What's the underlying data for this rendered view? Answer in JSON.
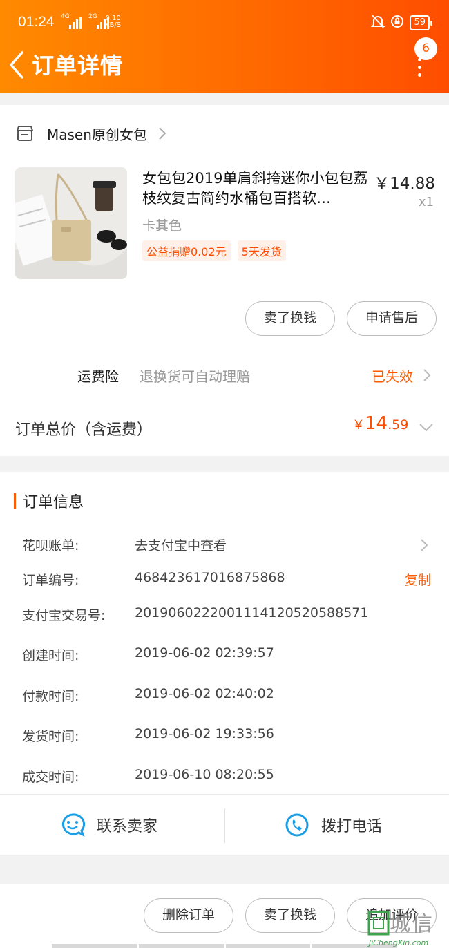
{
  "status_bar": {
    "time": "01:24",
    "net1_tag": "4G",
    "net2_tag": "2G",
    "speed_value": "0.10",
    "speed_unit": "KB/S",
    "battery": "59"
  },
  "header": {
    "title": "订单详情",
    "badge_count": "6"
  },
  "shop": {
    "name": "Masen原创女包"
  },
  "product": {
    "title": "女包包2019单肩斜挎迷你小包包荔枝纹复古简约水桶包百搭软…",
    "price": "￥14.88",
    "quantity": "x1",
    "sku": "卡其色",
    "tags": [
      "公益捐赠0.02元",
      "5天发货"
    ]
  },
  "item_actions": {
    "sell_label": "卖了换钱",
    "after_sale_label": "申请售后"
  },
  "insurance": {
    "name": "运费险",
    "desc": "退换货可自动理赔",
    "status": "已失效"
  },
  "total": {
    "label": "订单总价（含运费）",
    "symbol": "￥",
    "integer": "14",
    "decimal": ".59"
  },
  "order_info": {
    "heading": "订单信息",
    "rows": [
      {
        "label": "花呗账单:",
        "value": "去支付宝中查看"
      },
      {
        "label": "订单编号:",
        "value": "468423617016875868",
        "action": "复制"
      },
      {
        "label": "支付宝交易号:",
        "value": "2019060222001114120520588571"
      },
      {
        "label": "创建时间:",
        "value": "2019-06-02 02:39:57"
      },
      {
        "label": "付款时间:",
        "value": "2019-06-02 02:40:02"
      },
      {
        "label": "发货时间:",
        "value": "2019-06-02 19:33:56"
      },
      {
        "label": "成交时间:",
        "value": "2019-06-10 08:20:55"
      }
    ]
  },
  "contact": {
    "seller_label": "联系卖家",
    "call_label": "拨打电话"
  },
  "bottom_actions": {
    "delete_label": "删除订单",
    "sell_label": "卖了换钱",
    "review_label": "追加评价"
  },
  "watermark": {
    "text": "城信",
    "subtext": "JiChengXin.com"
  },
  "colors": {
    "accent": "#ff5a00",
    "header_start": "#ff8a00",
    "header_end": "#ff4d00",
    "link_blue": "#1a9ee6"
  }
}
